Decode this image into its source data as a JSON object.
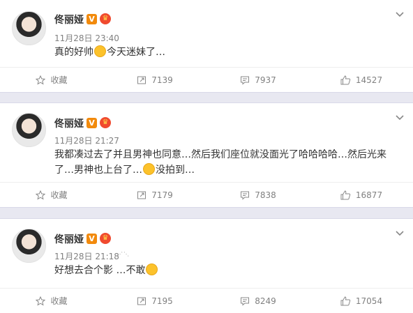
{
  "posts": [
    {
      "author": "佟丽娅",
      "time": "11月28日 23:40",
      "text_before_emoji": "真的好帅",
      "text_after_emoji": "今天迷妹了…",
      "toolbar": {
        "favorite": "收藏",
        "repost": "7139",
        "comment": "7937",
        "like": "14527"
      }
    },
    {
      "author": "佟丽娅",
      "time": "11月28日 21:27",
      "text_line1": "我都凑过去了并且男神也同意…然后我们座位就没面光了哈哈哈哈…然后光来",
      "text_line2_before": "了…男神也上台了…",
      "text_line2_after": "没拍到…",
      "toolbar": {
        "favorite": "收藏",
        "repost": "7179",
        "comment": "7838",
        "like": "16877"
      }
    },
    {
      "author": "佟丽娅",
      "time": "11月28日 21:18",
      "text_before_emoji": "好想去合个影 …不敢",
      "toolbar": {
        "favorite": "收藏",
        "repost": "7195",
        "comment": "8249",
        "like": "17054"
      }
    }
  ],
  "icons": {
    "verified": "V",
    "crown": "♛"
  },
  "colors": {
    "separator": "#e8e8f1",
    "verified": "#f28a0c",
    "meta": "#808080"
  }
}
